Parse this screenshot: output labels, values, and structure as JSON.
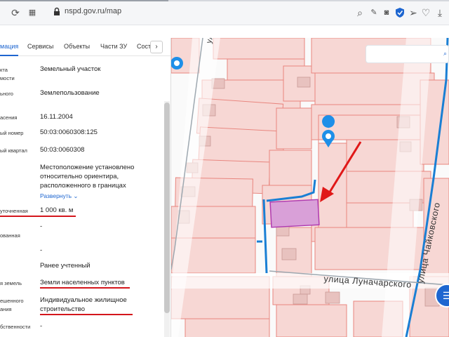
{
  "browser": {
    "url": "nspd.gov.ru/map",
    "icons": [
      "reload-icon",
      "tabs-grid-icon",
      "lock-icon",
      "zoom-icon",
      "edit-icon",
      "camera-icon",
      "shield-icon",
      "send-icon",
      "heart-icon",
      "download-icon"
    ]
  },
  "panel": {
    "tabs": [
      "мация",
      "Сервисы",
      "Объекты",
      "Части ЗУ",
      "Сост"
    ],
    "rows": [
      {
        "label_lines": [
          "кта",
          "мости"
        ],
        "value": "Земельный участок"
      },
      {
        "label_lines": [
          "ьного"
        ],
        "value": "Землепользование"
      },
      {
        "label_lines": [
          "асения"
        ],
        "value": "16.11.2004"
      },
      {
        "label_lines": [
          "ый номер"
        ],
        "value": "50:03:0060308:125"
      },
      {
        "label_lines": [
          "ый квартал"
        ],
        "value": "50:03:0060308"
      },
      {
        "label_lines": [],
        "value_lines": [
          "Местоположение установлено",
          "относительно ориентира,",
          "расположенного в границах"
        ]
      },
      {
        "label_lines": [
          "уточненная"
        ],
        "value": "1 000 кв. м"
      },
      {
        "label_lines": [
          "ованная"
        ],
        "value": "-"
      },
      {
        "label_lines": [],
        "value": "-"
      },
      {
        "label_lines": [],
        "value": "Ранее учтенный"
      },
      {
        "label_lines": [
          "я земель"
        ],
        "value": "Земли населенных пунктов"
      },
      {
        "label_lines": [
          "ешенного",
          "ания"
        ],
        "value_lines": [
          "Индивидуальное жилищное",
          "строительство"
        ]
      },
      {
        "label_lines": [
          "бственности"
        ],
        "value": "-"
      }
    ],
    "expand_link": "Развернуть ⌄",
    "next_tab": "›"
  },
  "map": {
    "streets": {
      "luna": "улица  Луначарского",
      "chaik": "улица  Чайковского",
      "top": "ули"
    },
    "fab_icon": "☰",
    "colors": {
      "parcel_fill": "#f7d7d4",
      "parcel_stroke": "#e8857e",
      "selected_fill": "#d9a0d8",
      "selected_stroke": "#b03bb0",
      "road": "#1a7fd4",
      "arrow": "#e01818",
      "pin": "#1e8fe8"
    }
  }
}
